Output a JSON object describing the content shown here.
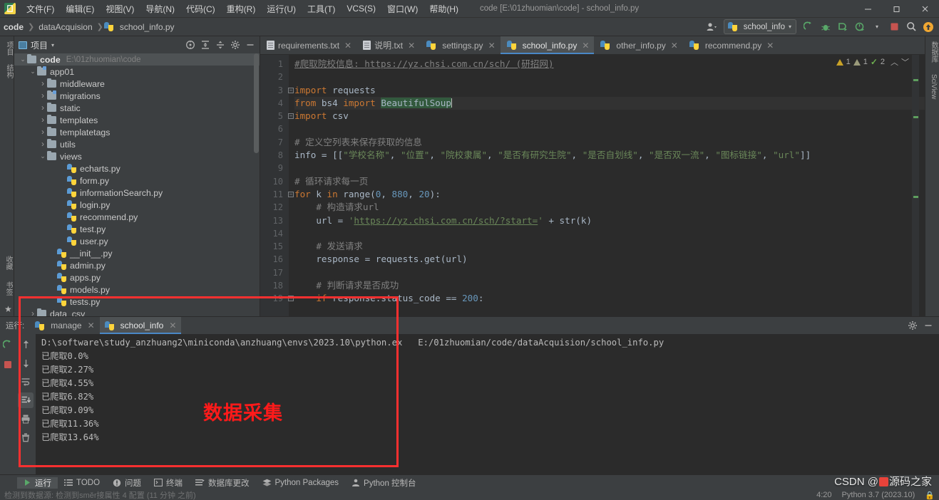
{
  "window": {
    "title": "code [E:\\01zhuomian\\code] - school_info.py",
    "minimize": "—",
    "maximize": "❐",
    "close": "✕"
  },
  "menubar": {
    "items": [
      {
        "label": "文件(F)",
        "name": "menu-file"
      },
      {
        "label": "编辑(E)",
        "name": "menu-edit"
      },
      {
        "label": "视图(V)",
        "name": "menu-view"
      },
      {
        "label": "导航(N)",
        "name": "menu-navigate"
      },
      {
        "label": "代码(C)",
        "name": "menu-code"
      },
      {
        "label": "重构(R)",
        "name": "menu-refactor"
      },
      {
        "label": "运行(U)",
        "name": "menu-run"
      },
      {
        "label": "工具(T)",
        "name": "menu-tools"
      },
      {
        "label": "VCS(S)",
        "name": "menu-vcs"
      },
      {
        "label": "窗口(W)",
        "name": "menu-window"
      },
      {
        "label": "帮助(H)",
        "name": "menu-help"
      }
    ]
  },
  "breadcrumb": {
    "root": "code",
    "sep": "❯",
    "folder": "dataAcquision",
    "file": "school_info.py"
  },
  "toolbar": {
    "run_config": "school_info",
    "caret": "▾",
    "icons": [
      {
        "name": "profiler-icon",
        "glyph": "⚗"
      },
      {
        "name": "run-icon",
        "glyph": "▶"
      },
      {
        "name": "debug-icon",
        "glyph": "🐞"
      },
      {
        "name": "run-coverage-icon",
        "glyph": "▶"
      },
      {
        "name": "profile-run-icon",
        "glyph": "◔"
      },
      {
        "name": "stop-icon",
        "glyph": "■"
      },
      {
        "name": "search-everywhere-icon",
        "glyph": "🔍"
      },
      {
        "name": "update-icon",
        "glyph": "↑"
      }
    ]
  },
  "project_panel": {
    "title": "项目",
    "caret": "▾",
    "tools": [
      "select-opened-file-icon",
      "expand-all-icon",
      "collapse-all-icon",
      "settings-icon",
      "hide-icon"
    ],
    "tree": [
      {
        "label": "code",
        "path": "E:\\01zhuomian\\code",
        "type": "folder",
        "indent": 0,
        "arrow": "v",
        "bold": true,
        "selected": true
      },
      {
        "label": "app01",
        "path": "",
        "type": "folder-mod",
        "indent": 1,
        "arrow": "v",
        "bold": false,
        "selected": false
      },
      {
        "label": "middleware",
        "path": "",
        "type": "folder",
        "indent": 2,
        "arrow": ">",
        "bold": false,
        "selected": false
      },
      {
        "label": "migrations",
        "path": "",
        "type": "folder-mod",
        "indent": 2,
        "arrow": ">",
        "bold": false,
        "selected": false
      },
      {
        "label": "static",
        "path": "",
        "type": "folder",
        "indent": 2,
        "arrow": ">",
        "bold": false,
        "selected": false
      },
      {
        "label": "templates",
        "path": "",
        "type": "folder",
        "indent": 2,
        "arrow": ">",
        "bold": false,
        "selected": false
      },
      {
        "label": "templatetags",
        "path": "",
        "type": "folder",
        "indent": 2,
        "arrow": ">",
        "bold": false,
        "selected": false
      },
      {
        "label": "utils",
        "path": "",
        "type": "folder",
        "indent": 2,
        "arrow": ">",
        "bold": false,
        "selected": false
      },
      {
        "label": "views",
        "path": "",
        "type": "folder",
        "indent": 2,
        "arrow": "v",
        "bold": false,
        "selected": false
      },
      {
        "label": "echarts.py",
        "path": "",
        "type": "python",
        "indent": 4,
        "arrow": "",
        "bold": false,
        "selected": false
      },
      {
        "label": "form.py",
        "path": "",
        "type": "python",
        "indent": 4,
        "arrow": "",
        "bold": false,
        "selected": false
      },
      {
        "label": "informationSearch.py",
        "path": "",
        "type": "python",
        "indent": 4,
        "arrow": "",
        "bold": false,
        "selected": false
      },
      {
        "label": "login.py",
        "path": "",
        "type": "python",
        "indent": 4,
        "arrow": "",
        "bold": false,
        "selected": false
      },
      {
        "label": "recommend.py",
        "path": "",
        "type": "python",
        "indent": 4,
        "arrow": "",
        "bold": false,
        "selected": false
      },
      {
        "label": "test.py",
        "path": "",
        "type": "python",
        "indent": 4,
        "arrow": "",
        "bold": false,
        "selected": false
      },
      {
        "label": "user.py",
        "path": "",
        "type": "python",
        "indent": 4,
        "arrow": "",
        "bold": false,
        "selected": false
      },
      {
        "label": "__init__.py",
        "path": "",
        "type": "python",
        "indent": 3,
        "arrow": "",
        "bold": false,
        "selected": false
      },
      {
        "label": "admin.py",
        "path": "",
        "type": "python",
        "indent": 3,
        "arrow": "",
        "bold": false,
        "selected": false
      },
      {
        "label": "apps.py",
        "path": "",
        "type": "python",
        "indent": 3,
        "arrow": "",
        "bold": false,
        "selected": false
      },
      {
        "label": "models.py",
        "path": "",
        "type": "python",
        "indent": 3,
        "arrow": "",
        "bold": false,
        "selected": false
      },
      {
        "label": "tests.py",
        "path": "",
        "type": "python",
        "indent": 3,
        "arrow": "",
        "bold": false,
        "selected": false
      },
      {
        "label": "data_csv",
        "path": "",
        "type": "folder",
        "indent": 1,
        "arrow": ">",
        "bold": false,
        "selected": false
      }
    ]
  },
  "editor_tabs": [
    {
      "label": "requirements.txt",
      "type": "txt",
      "active": false
    },
    {
      "label": "说明.txt",
      "type": "txt",
      "active": false
    },
    {
      "label": "settings.py",
      "type": "python",
      "active": false
    },
    {
      "label": "school_info.py",
      "type": "python",
      "active": true
    },
    {
      "label": "other_info.py",
      "type": "python",
      "active": false
    },
    {
      "label": "recommend.py",
      "type": "python",
      "active": false
    }
  ],
  "editor": {
    "close_glyph": "✕",
    "inspection": {
      "warning_count": "1",
      "weak_warning_count": "1",
      "ok_count": "2",
      "prev_glyph": "︿",
      "next_glyph": "﹀"
    },
    "lines": [
      {
        "n": "1",
        "fold": "",
        "text": "#爬取院校信息: https://yz.chsi.com.cn/sch/ (研招网)"
      },
      {
        "n": "2",
        "fold": "",
        "text": ""
      },
      {
        "n": "3",
        "fold": "-",
        "text": "import requests"
      },
      {
        "n": "4",
        "fold": "",
        "text": "from bs4 import BeautifulSoup"
      },
      {
        "n": "5",
        "fold": "-",
        "text": "import csv"
      },
      {
        "n": "6",
        "fold": "",
        "text": ""
      },
      {
        "n": "7",
        "fold": "",
        "text": "# 定义空列表来保存获取的信息"
      },
      {
        "n": "8",
        "fold": "",
        "text": "info = [[\"学校名称\", \"位置\", \"院校隶属\", \"是否有研究生院\", \"是否自划线\", \"是否双一流\", \"图标链接\", \"url\"]]"
      },
      {
        "n": "9",
        "fold": "",
        "text": ""
      },
      {
        "n": "10",
        "fold": "",
        "text": "# 循环请求每一页"
      },
      {
        "n": "11",
        "fold": "-",
        "text": "for k in range(0, 880, 20):"
      },
      {
        "n": "12",
        "fold": "",
        "text": "    # 构造请求url"
      },
      {
        "n": "13",
        "fold": "",
        "text": "    url = 'https://yz.chsi.com.cn/sch/?start=' + str(k)"
      },
      {
        "n": "14",
        "fold": "",
        "text": ""
      },
      {
        "n": "15",
        "fold": "",
        "text": "    # 发送请求"
      },
      {
        "n": "16",
        "fold": "",
        "text": "    response = requests.get(url)"
      },
      {
        "n": "17",
        "fold": "",
        "text": ""
      },
      {
        "n": "18",
        "fold": "",
        "text": "    # 判断请求是否成功"
      },
      {
        "n": "19",
        "fold": "-",
        "text": "    if response.status_code == 200:"
      }
    ]
  },
  "left_rail": {
    "top": [
      "项目",
      "结构"
    ],
    "bottom": [
      "收藏",
      "书签"
    ]
  },
  "right_rail": {
    "items": [
      "数据库",
      "SciView"
    ]
  },
  "run_panel": {
    "label": "运行:",
    "tabs": [
      {
        "label": "manage",
        "active": false
      },
      {
        "label": "school_info",
        "active": true
      }
    ],
    "close_glyph": "✕",
    "head_icons": [
      "settings-icon",
      "hide-icon"
    ],
    "tools": [
      {
        "name": "rerun-icon",
        "glyph": "▶"
      },
      {
        "name": "stop-icon",
        "glyph": "■"
      },
      {
        "name": "scroll-up-icon",
        "glyph": "↑"
      },
      {
        "name": "scroll-down-icon",
        "glyph": "↓"
      },
      {
        "name": "soft-wrap-icon",
        "glyph": "⇥"
      },
      {
        "name": "scroll-to-end-icon",
        "glyph": "⇲"
      },
      {
        "name": "print-icon",
        "glyph": "🖶"
      },
      {
        "name": "clear-all-icon",
        "glyph": "🗑"
      }
    ],
    "console_lines": [
      "D:\\software\\study_anzhuang2\\miniconda\\anzhuang\\envs\\2023.10\\python.ex   E:/01zhuomian/code/dataAcquision/school_info.py",
      "已爬取0.0%",
      "已爬取2.27%",
      "已爬取4.55%",
      "已爬取6.82%",
      "已爬取9.09%",
      "已爬取11.36%",
      "已爬取13.64%"
    ]
  },
  "bottom_bar": {
    "items": [
      {
        "label": "运行",
        "name": "bottom-tab-run",
        "icon": "run-icon",
        "active": true
      },
      {
        "label": "TODO",
        "name": "bottom-tab-todo",
        "icon": "todo-icon",
        "active": false
      },
      {
        "label": "问题",
        "name": "bottom-tab-problems",
        "icon": "problems-icon",
        "active": false
      },
      {
        "label": "终端",
        "name": "bottom-tab-terminal",
        "icon": "terminal-icon",
        "active": false
      },
      {
        "label": "数据库更改",
        "name": "bottom-tab-db-changes",
        "icon": "database-icon",
        "active": false
      },
      {
        "label": "Python Packages",
        "name": "bottom-tab-python-packages",
        "icon": "packages-icon",
        "active": false
      },
      {
        "label": "Python 控制台",
        "name": "bottom-tab-python-console",
        "icon": "console-icon",
        "active": false
      }
    ]
  },
  "status_bar": {
    "message": "检测到数据源: 检测到směr接属性   4 配置 (11 分钟 之前)",
    "position": "4:20",
    "interpreter": "Python 3.7 (2023.10)",
    "lock": "🔒"
  },
  "annotations": {
    "region_label": "数据采集",
    "watermark_prefix": "CSDN @",
    "watermark_name": "源码之家"
  },
  "colors": {
    "accent_blue": "#4a88c7",
    "annotation_red": "#fc3030",
    "panel_bg": "#3c3f41",
    "editor_bg": "#2b2b2b"
  }
}
